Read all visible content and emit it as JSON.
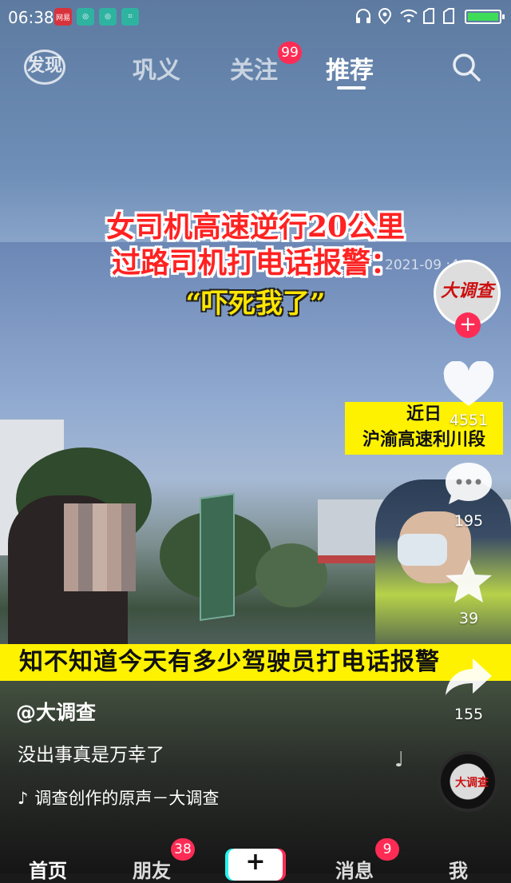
{
  "status_bar": {
    "time": "06:38",
    "app_icon_1": "网易",
    "battery_level": 1.0
  },
  "top_tabs": {
    "discover_label": "发现",
    "tabs": [
      {
        "label": "巩义"
      },
      {
        "label": "关注",
        "badge": "99"
      },
      {
        "label": "推荐",
        "active": true
      }
    ]
  },
  "video": {
    "headline_line1": "女司机高速逆行20公里",
    "headline_line2": "过路司机打电话报警：",
    "quote": "“吓死我了”",
    "timestamp": "2021-09 :4",
    "location_line1": "近日",
    "location_line2": "沪渝高速利川段",
    "subtitle": "知不知道今天有多少驾驶员打电话报警"
  },
  "sidebar": {
    "avatar_text": "大调查",
    "follow_symbol": "+",
    "likes": "4551",
    "comments": "195",
    "favorites": "39",
    "shares": "155"
  },
  "post": {
    "author": "@大调查",
    "description": "没出事真是万幸了",
    "music": "调查创作的原声－大调查",
    "disc_text": "大调查"
  },
  "bottom_nav": {
    "items": [
      {
        "label": "首页"
      },
      {
        "label": "朋友",
        "badge": "38"
      },
      {
        "label": "消息",
        "badge": "9"
      },
      {
        "label": "我"
      }
    ],
    "plus_label": "+"
  },
  "colors": {
    "accent": "#fe2c55",
    "caption_yellow": "#fff200",
    "headline_red": "#ff2222"
  }
}
